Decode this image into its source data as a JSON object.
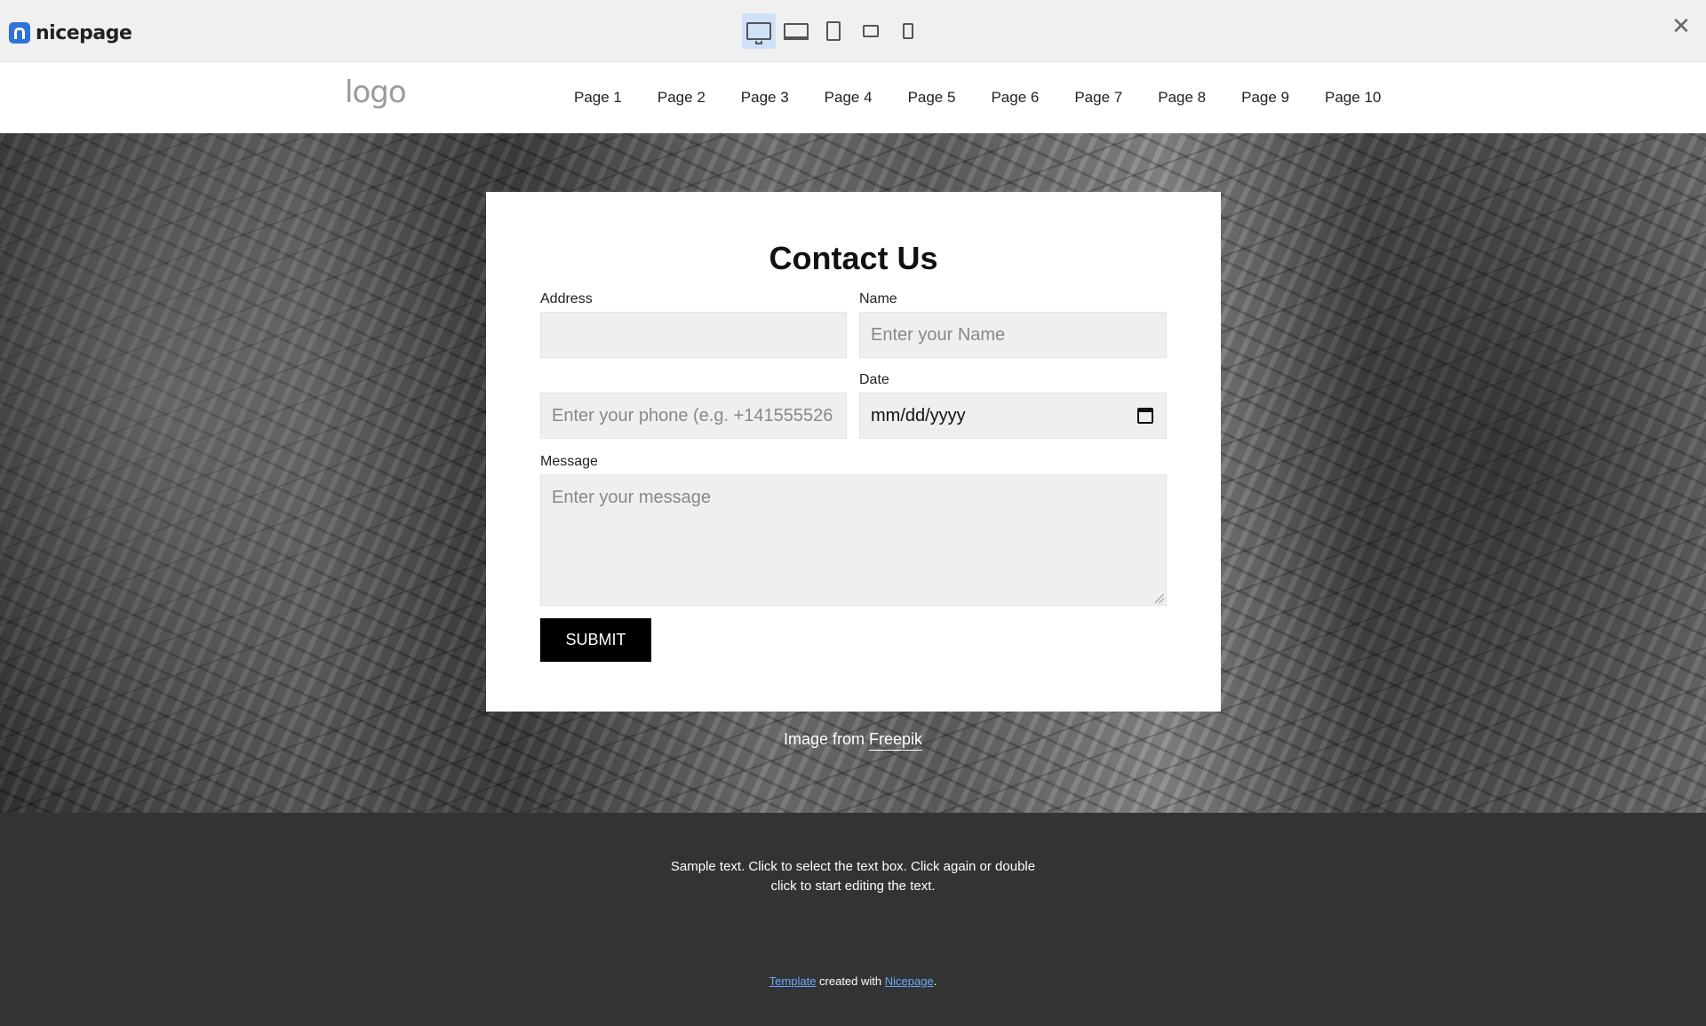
{
  "toolbar": {
    "brand": "nicepage",
    "devices": [
      "desktop-icon",
      "laptop-icon",
      "tablet-icon",
      "tablet-landscape-icon",
      "phone-icon"
    ],
    "active_device": "desktop",
    "close": "✕"
  },
  "header": {
    "logo": "logo",
    "nav": [
      "Page 1",
      "Page 2",
      "Page 3",
      "Page 4",
      "Page 5",
      "Page 6",
      "Page 7",
      "Page 8",
      "Page 9",
      "Page 10"
    ]
  },
  "form": {
    "title": "Contact Us",
    "address_label": "Address",
    "address_value": "",
    "name_label": "Name",
    "name_placeholder": "Enter your Name",
    "phone_placeholder": "Enter your phone (e.g. +141555526",
    "date_label": "Date",
    "date_value": "mm/dd/yyyy",
    "message_label": "Message",
    "message_placeholder": "Enter your message",
    "submit": "SUBMIT"
  },
  "credit": {
    "prefix": "Image from ",
    "link": "Freepik"
  },
  "footer": {
    "text": "Sample text. Click to select the text box. Click again or double click to start editing the text.",
    "credit_link1": "Template",
    "credit_middle": " created with ",
    "credit_link2": "Nicepage",
    "credit_end": "."
  },
  "colors": {
    "accent": "#2e72d9",
    "footer_bg": "#333333",
    "link": "#6aa8ff",
    "button_bg": "#000000"
  }
}
